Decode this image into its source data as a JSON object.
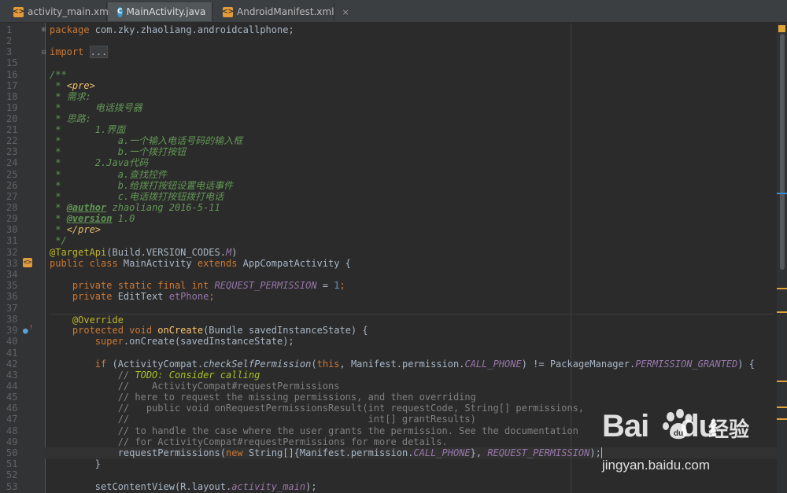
{
  "tabs": [
    {
      "label": "activity_main.xml",
      "icon": "xml-file-icon",
      "close": "×"
    },
    {
      "label": "MainActivity.java",
      "icon": "java-class-icon",
      "close": "×"
    },
    {
      "label": "AndroidManifest.xml",
      "icon": "xml-file-icon",
      "close": "×"
    }
  ],
  "active_tab": 1,
  "line_numbers": [
    "1",
    "2",
    "3",
    "15",
    "16",
    "17",
    "18",
    "19",
    "20",
    "21",
    "22",
    "23",
    "24",
    "25",
    "26",
    "27",
    "28",
    "29",
    "30",
    "31",
    "32",
    "33",
    "34",
    "35",
    "36",
    "37",
    "38",
    "39",
    "40",
    "41",
    "42",
    "43",
    "44",
    "45",
    "46",
    "47",
    "48",
    "49",
    "50",
    "51",
    "52",
    "53"
  ],
  "code": {
    "l1_kw": "package",
    "l1_rest": " com.zky.zhaoliang.androidcallphone;",
    "l3_kw": "import",
    "l3_fold": "...",
    "l16": "/**",
    "l17_a": " * ",
    "l17_tag": "<pre>",
    "l18": " * 需求:",
    "l19": " *      电话拨号器",
    "l20": " * 思路:",
    "l21": " *      1.界面",
    "l22": " *          a.一个输入电话号码的输入框",
    "l23": " *          b.一个拨打按钮",
    "l24": " *      2.Java代码",
    "l25": " *          a.查找控件",
    "l26": " *          b.给拨打按钮设置电话事件",
    "l27": " *          c.电话拨打按钮拨打电话",
    "l28_a": " * ",
    "l28_tag": "@author",
    "l28_b": " zhaoliang 2016-5-11",
    "l29_a": " * ",
    "l29_tag": "@version",
    "l29_b": " 1.0",
    "l30_a": " * ",
    "l30_tag": "</pre>",
    "l31": " */",
    "l32_ann": "@TargetApi",
    "l32_a": "(Build.VERSION_CODES.",
    "l32_cn": "M",
    "l32_b": ")",
    "l33_kw": "public class ",
    "l33_a": "MainActivity ",
    "l33_kw2": "extends ",
    "l33_b": "AppCompatActivity {",
    "l35_kw": "    private static final int ",
    "l35_cn": "REQUEST_PERMISSION",
    "l35_a": " = ",
    "l35_num": "1",
    "l35_b": ";",
    "l36_kw": "    private ",
    "l36_a": "EditText ",
    "l36_cn": "etPhone",
    "l36_b": ";",
    "l38_ann": "    @Override",
    "l39_kw": "    protected void ",
    "l39_fn": "onCreate",
    "l39_a": "(Bundle savedInstanceState) {",
    "l40_kw": "        super",
    "l40_a": ".onCreate(savedInstanceState);",
    "l42_kw": "        if ",
    "l42_a": "(ActivityCompat.",
    "l42_it": "checkSelfPermission",
    "l42_b": "(",
    "l42_kw2": "this",
    "l42_c": ", Manifest.permission.",
    "l42_cn": "CALL_PHONE",
    "l42_d": ") != PackageManager.",
    "l42_cn2": "PERMISSION_GRANTED",
    "l42_e": ") {",
    "l43_a": "            // ",
    "l43_todo": "TODO: Consider calling",
    "l44": "            //    ActivityCompat#requestPermissions",
    "l45": "            // here to request the missing permissions, and then overriding",
    "l46": "            //   public void onRequestPermissionsResult(int requestCode, String[] permissions,",
    "l47": "            //                                          int[] grantResults)",
    "l48": "            // to handle the case where the user grants the permission. See the documentation",
    "l49": "            // for ActivityCompat#requestPermissions for more details.",
    "l50_a": "            requestPermissions(",
    "l50_kw": "new ",
    "l50_b": "String[]{Manifest.permission.",
    "l50_cn": "CALL_PHONE",
    "l50_c": "}, ",
    "l50_cn2": "REQUEST_PERMISSION",
    "l50_d": ");",
    "l51": "        }",
    "l53_a": "        setContentView(R.layout.",
    "l53_cn": "activity_main",
    "l53_b": ");"
  },
  "watermark": {
    "logo": "Bai",
    "logo2": "du",
    "cn": "经验",
    "url": "jingyan.baidu.com"
  },
  "colors": {
    "keyword": "#cc7832",
    "comment": "#629755",
    "annotation": "#bbb529",
    "method": "#ffc66d",
    "constant": "#9876aa",
    "number": "#6897bb"
  }
}
